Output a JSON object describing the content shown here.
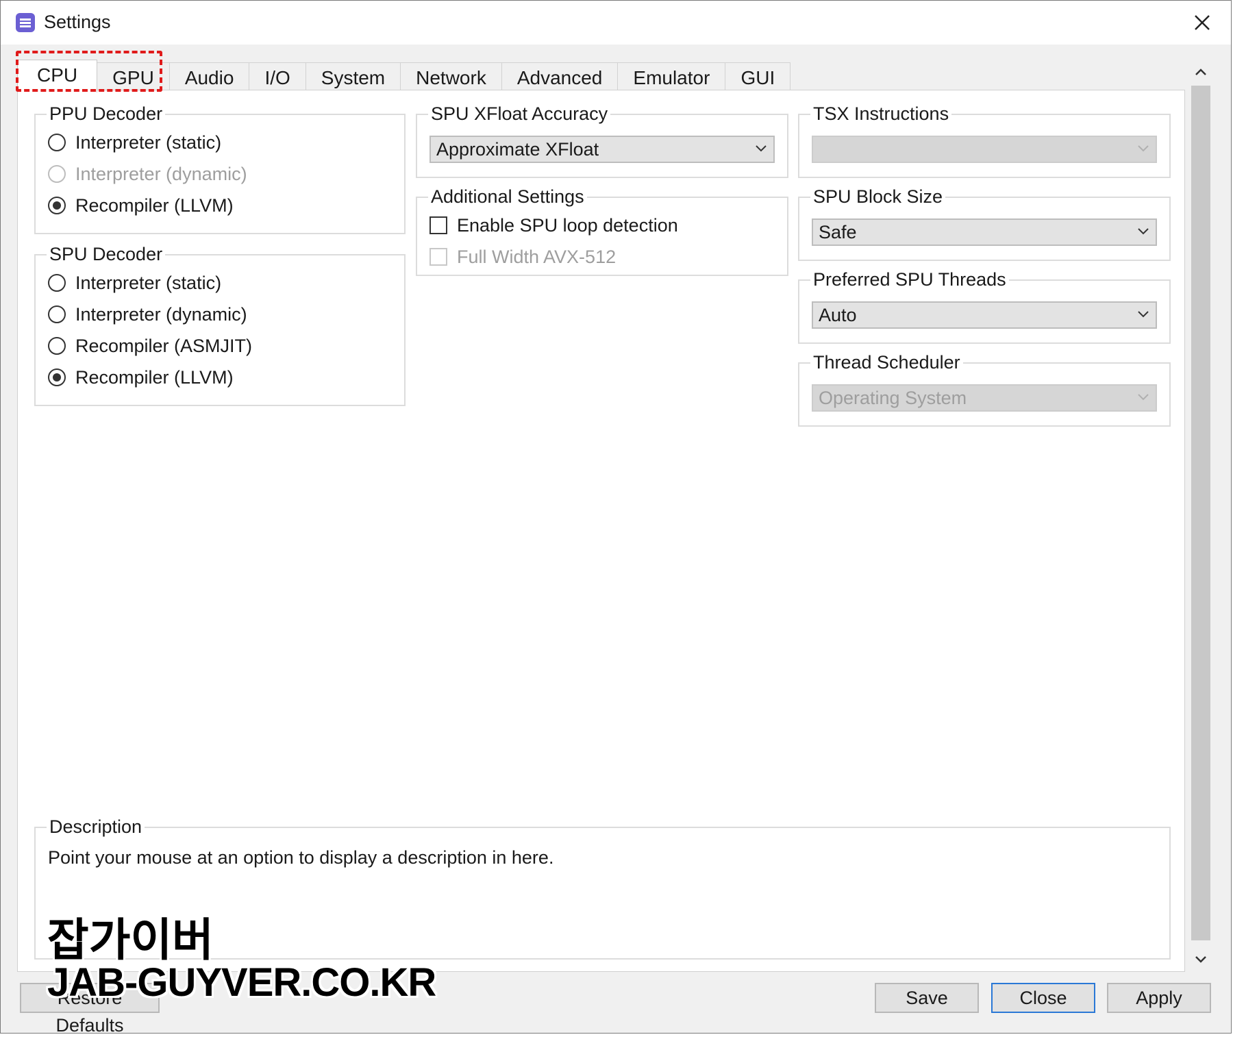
{
  "window": {
    "title": "Settings"
  },
  "tabs": [
    "CPU",
    "GPU",
    "Audio",
    "I/O",
    "System",
    "Network",
    "Advanced",
    "Emulator",
    "GUI"
  ],
  "active_tab": "CPU",
  "ppu_decoder": {
    "title": "PPU Decoder",
    "options": [
      {
        "label": "Interpreter (static)",
        "checked": false,
        "disabled": false
      },
      {
        "label": "Interpreter (dynamic)",
        "checked": false,
        "disabled": true
      },
      {
        "label": "Recompiler (LLVM)",
        "checked": true,
        "disabled": false
      }
    ]
  },
  "spu_decoder": {
    "title": "SPU Decoder",
    "options": [
      {
        "label": "Interpreter (static)",
        "checked": false
      },
      {
        "label": "Interpreter (dynamic)",
        "checked": false
      },
      {
        "label": "Recompiler (ASMJIT)",
        "checked": false
      },
      {
        "label": "Recompiler (LLVM)",
        "checked": true
      }
    ]
  },
  "spu_xfloat": {
    "title": "SPU XFloat Accuracy",
    "value": "Approximate XFloat"
  },
  "additional": {
    "title": "Additional Settings",
    "loop_detection": "Enable SPU loop detection",
    "avx512": "Full Width AVX-512"
  },
  "tsx": {
    "title": "TSX Instructions",
    "value": ""
  },
  "spu_block": {
    "title": "SPU Block Size",
    "value": "Safe"
  },
  "spu_threads": {
    "title": "Preferred SPU Threads",
    "value": "Auto"
  },
  "scheduler": {
    "title": "Thread Scheduler",
    "value": "Operating System"
  },
  "description": {
    "title": "Description",
    "text": "Point your mouse at an option to display a description in here."
  },
  "buttons": {
    "restore": "Restore Defaults",
    "save": "Save",
    "close": "Close",
    "apply": "Apply"
  },
  "watermark": {
    "line1": "잡가이버",
    "line2": "JAB-GUYVER.CO.KR"
  },
  "colors": {
    "highlight": "#e01b1b",
    "default_button_border": "#2a78d6"
  }
}
